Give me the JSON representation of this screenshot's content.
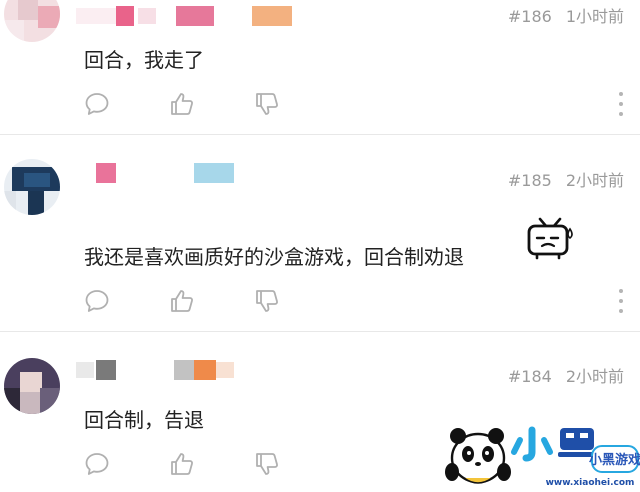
{
  "comments": [
    {
      "floor": "#186",
      "time": "1小时前",
      "text": "回合，我走了"
    },
    {
      "floor": "#185",
      "time": "2小时前",
      "text": "我还是喜欢画质好的沙盒游戏，回合制劝退"
    },
    {
      "floor": "#184",
      "time": "2小时前",
      "text": "回合制，告退"
    }
  ],
  "icons": {
    "reply": "speech-bubble-icon",
    "like": "thumbs-up-icon",
    "dislike": "thumbs-down-icon",
    "more": "more-vertical-icon",
    "emoji": "bilibili-tv-emoji"
  },
  "watermark": {
    "brand": "小黑游戏",
    "url": "www.xiaohei.com"
  },
  "colors": {
    "text": "#222222",
    "meta": "#9a9a9a",
    "icon": "#b0b0b0",
    "divider": "#e8e8e8"
  }
}
